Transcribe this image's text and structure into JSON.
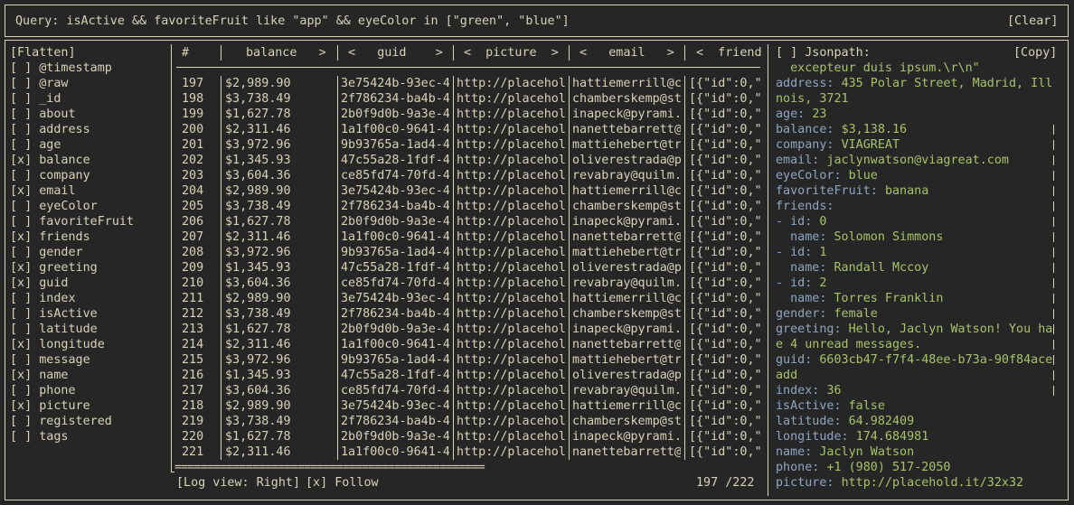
{
  "query": {
    "text": "Query: isActive && favoriteFruit like \"app\" && eyeColor in [\"green\", \"blue\"]",
    "clear_label": "[Clear]"
  },
  "fields": {
    "flatten_label": "[Flatten]",
    "items": [
      "[ ] @timestamp",
      "[ ] @raw",
      "[ ] _id",
      "[ ] about",
      "[ ] address",
      "[ ] age",
      "[x] balance",
      "[ ] company",
      "[x] email",
      "[ ] eyeColor",
      "[ ] favoriteFruit",
      "[x] friends",
      "[ ] gender",
      "[x] greeting",
      "[x] guid",
      "[ ] index",
      "[ ] isActive",
      "[ ] latitude",
      "[x] longitude",
      "[ ] message",
      "[x] name",
      "[ ] phone",
      "[x] picture",
      "[ ] registered",
      "[ ] tags"
    ]
  },
  "table": {
    "headers": {
      "index": "#",
      "balance": "balance   >",
      "guid": "<   guid    >",
      "picture": "<  picture  >",
      "email": "<   email   >",
      "friends": "<  friend"
    },
    "rows": [
      [
        "197",
        "$2,989.90",
        "3e75424b-93ec-4",
        "http://placehol",
        "hattiemerrill@c",
        "[{\"id\":0,\""
      ],
      [
        "198",
        "$3,738.49",
        "2f786234-ba4b-4",
        "http://placehol",
        "chamberskemp@st",
        "[{\"id\":0,\""
      ],
      [
        "199",
        "$1,627.78",
        "2b0f9d0b-9a3e-4",
        "http://placehol",
        "inapeck@pyrami.",
        "[{\"id\":0,\""
      ],
      [
        "200",
        "$2,311.46",
        "1a1f00c0-9641-4",
        "http://placehol",
        "nanettebarrett@",
        "[{\"id\":0,\""
      ],
      [
        "201",
        "$3,972.96",
        "9b93765a-1ad4-4",
        "http://placehol",
        "mattiehebert@tr",
        "[{\"id\":0,\""
      ],
      [
        "202",
        "$1,345.93",
        "47c55a28-1fdf-4",
        "http://placehol",
        "oliverestrada@p",
        "[{\"id\":0,\""
      ],
      [
        "203",
        "$3,604.36",
        "ce85fd74-70fd-4",
        "http://placehol",
        "revabray@quilm.",
        "[{\"id\":0,\""
      ],
      [
        "204",
        "$2,989.90",
        "3e75424b-93ec-4",
        "http://placehol",
        "hattiemerrill@c",
        "[{\"id\":0,\""
      ],
      [
        "205",
        "$3,738.49",
        "2f786234-ba4b-4",
        "http://placehol",
        "chamberskemp@st",
        "[{\"id\":0,\""
      ],
      [
        "206",
        "$1,627.78",
        "2b0f9d0b-9a3e-4",
        "http://placehol",
        "inapeck@pyrami.",
        "[{\"id\":0,\""
      ],
      [
        "207",
        "$2,311.46",
        "1a1f00c0-9641-4",
        "http://placehol",
        "nanettebarrett@",
        "[{\"id\":0,\""
      ],
      [
        "208",
        "$3,972.96",
        "9b93765a-1ad4-4",
        "http://placehol",
        "mattiehebert@tr",
        "[{\"id\":0,\""
      ],
      [
        "209",
        "$1,345.93",
        "47c55a28-1fdf-4",
        "http://placehol",
        "oliverestrada@p",
        "[{\"id\":0,\""
      ],
      [
        "210",
        "$3,604.36",
        "ce85fd74-70fd-4",
        "http://placehol",
        "revabray@quilm.",
        "[{\"id\":0,\""
      ],
      [
        "211",
        "$2,989.90",
        "3e75424b-93ec-4",
        "http://placehol",
        "hattiemerrill@c",
        "[{\"id\":0,\""
      ],
      [
        "212",
        "$3,738.49",
        "2f786234-ba4b-4",
        "http://placehol",
        "chamberskemp@st",
        "[{\"id\":0,\""
      ],
      [
        "213",
        "$1,627.78",
        "2b0f9d0b-9a3e-4",
        "http://placehol",
        "inapeck@pyrami.",
        "[{\"id\":0,\""
      ],
      [
        "214",
        "$2,311.46",
        "1a1f00c0-9641-4",
        "http://placehol",
        "nanettebarrett@",
        "[{\"id\":0,\""
      ],
      [
        "215",
        "$3,972.96",
        "9b93765a-1ad4-4",
        "http://placehol",
        "mattiehebert@tr",
        "[{\"id\":0,\""
      ],
      [
        "216",
        "$1,345.93",
        "47c55a28-1fdf-4",
        "http://placehol",
        "oliverestrada@p",
        "[{\"id\":0,\""
      ],
      [
        "217",
        "$3,604.36",
        "ce85fd74-70fd-4",
        "http://placehol",
        "revabray@quilm.",
        "[{\"id\":0,\""
      ],
      [
        "218",
        "$2,989.90",
        "3e75424b-93ec-4",
        "http://placehol",
        "hattiemerrill@c",
        "[{\"id\":0,\""
      ],
      [
        "219",
        "$3,738.49",
        "2f786234-ba4b-4",
        "http://placehol",
        "chamberskemp@st",
        "[{\"id\":0,\""
      ],
      [
        "220",
        "$1,627.78",
        "2b0f9d0b-9a3e-4",
        "http://placehol",
        "inapeck@pyrami.",
        "[{\"id\":0,\""
      ],
      [
        "221",
        "$2,311.46",
        "1a1f00c0-9641-4",
        "http://placehol",
        "nanettebarrett@",
        "[{\"id\":0,\""
      ]
    ],
    "scroll_indicator": "================================================",
    "log_view_label": "[Log view: Right]",
    "follow_label": "[x] Follow",
    "position": "197 /222"
  },
  "detail": {
    "jsonpath_label": "[ ] Jsonpath:",
    "copy_label": "[Copy]",
    "lines": [
      {
        "k": "",
        "v": "  excepteur duis ipsum.\\r\\n\""
      },
      {
        "k": "address: ",
        "v": "435 Polar Street, Madrid, Ill"
      },
      {
        "k": "",
        "v": "nois, 3721"
      },
      {
        "k": "age: ",
        "v": "23"
      },
      {
        "k": "balance: ",
        "v": "$3,138.16"
      },
      {
        "k": "company: ",
        "v": "VIAGREAT"
      },
      {
        "k": "email: ",
        "v": "jaclynwatson@viagreat.com"
      },
      {
        "k": "eyeColor: ",
        "v": "blue"
      },
      {
        "k": "favoriteFruit: ",
        "v": "banana"
      },
      {
        "k": "friends:",
        "v": ""
      },
      {
        "k": "- id: ",
        "v": "0"
      },
      {
        "k": "  name: ",
        "v": "Solomon Simmons"
      },
      {
        "k": "- id: ",
        "v": "1"
      },
      {
        "k": "  name: ",
        "v": "Randall Mccoy"
      },
      {
        "k": "- id: ",
        "v": "2"
      },
      {
        "k": "  name: ",
        "v": "Torres Franklin"
      },
      {
        "k": "gender: ",
        "v": "female"
      },
      {
        "k": "greeting: ",
        "v": "Hello, Jaclyn Watson! You ha"
      },
      {
        "k": "",
        "v": "e 4 unread messages."
      },
      {
        "k": "guid: ",
        "v": "6603cb47-f7f4-48ee-b73a-90f84ace"
      },
      {
        "k": "",
        "v": "add"
      },
      {
        "k": "index: ",
        "v": "36"
      },
      {
        "k": "isActive: ",
        "v": "false"
      },
      {
        "k": "latitude: ",
        "v": "64.982409"
      },
      {
        "k": "longitude: ",
        "v": "174.684981"
      },
      {
        "k": "name: ",
        "v": "Jaclyn Watson"
      },
      {
        "k": "phone: ",
        "v": "+1 (980) 517-2050"
      },
      {
        "k": "picture: ",
        "v": "http://placehold.it/32x32"
      }
    ]
  },
  "colors": {
    "background": "#262626",
    "foreground": "#d8d2b8",
    "key": "#8fa6c2",
    "value": "#a8c26a"
  }
}
